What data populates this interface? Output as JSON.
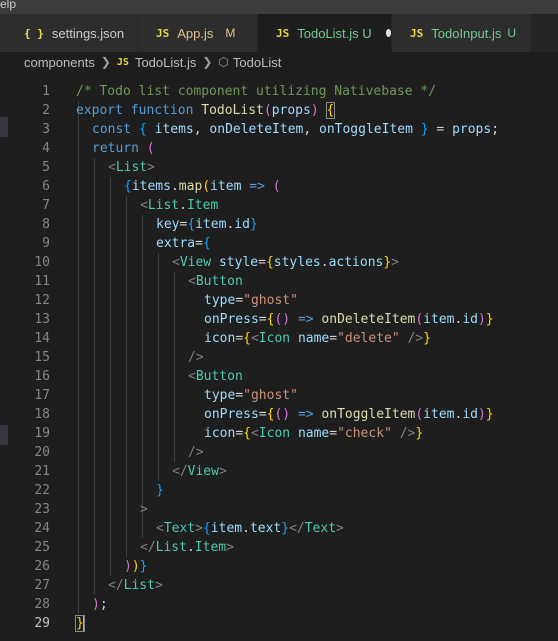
{
  "menubar": {
    "label": "elp"
  },
  "tabs": [
    {
      "icon": "{ }",
      "label": "settings.json",
      "status": ""
    },
    {
      "icon": "JS",
      "label": "App.js",
      "status": "M"
    },
    {
      "icon": "JS",
      "label": "TodoList.js U",
      "status": ""
    },
    {
      "icon": "JS",
      "label": "TodoInput.js",
      "status": "U"
    }
  ],
  "breadcrumb": {
    "folder": "components",
    "file_icon": "JS",
    "file": "TodoList.js",
    "symbol": "TodoList"
  },
  "colors": {
    "comment": "#6a9955",
    "keyword": "#569cd6",
    "function": "#dcdcaa",
    "variable": "#9cdcfe",
    "component": "#4ec9b0",
    "string": "#ce9178",
    "bracket1": "#ffd700",
    "bracket2": "#da70d6",
    "bracket3": "#179fff",
    "modified": "#e2c08d",
    "untracked": "#73c991"
  },
  "editor": {
    "current_line": 29,
    "lines": [
      {
        "n": 1,
        "tokens": [
          [
            "/* Todo list component utilizing Nativebase */",
            "com"
          ]
        ]
      },
      {
        "n": 2,
        "tokens": [
          [
            "export",
            "kw"
          ],
          [
            " ",
            "pun"
          ],
          [
            "function",
            "kw"
          ],
          [
            " ",
            "pun"
          ],
          [
            "TodoList",
            "fn"
          ],
          [
            "(",
            "br2"
          ],
          [
            "props",
            "var"
          ],
          [
            ")",
            "br2"
          ],
          [
            " ",
            "pun"
          ],
          [
            "{",
            "br1"
          ]
        ]
      },
      {
        "n": 3,
        "tokens": [
          [
            "const",
            "kw"
          ],
          [
            " ",
            "pun"
          ],
          [
            "{",
            "br3"
          ],
          [
            " ",
            "pun"
          ],
          [
            "items",
            "var"
          ],
          [
            ", ",
            "pun"
          ],
          [
            "onDeleteItem",
            "var"
          ],
          [
            ", ",
            "pun"
          ],
          [
            "onToggleItem",
            "var"
          ],
          [
            " ",
            "pun"
          ],
          [
            "}",
            "br3"
          ],
          [
            " = ",
            "pun"
          ],
          [
            "props",
            "var"
          ],
          [
            ";",
            "pun"
          ]
        ]
      },
      {
        "n": 4,
        "tokens": [
          [
            "return",
            "kw"
          ],
          [
            " ",
            "pun"
          ],
          [
            "(",
            "br2"
          ]
        ]
      },
      {
        "n": 5,
        "tokens": [
          [
            "<",
            "tag"
          ],
          [
            "List",
            "cmp"
          ],
          [
            ">",
            "tag"
          ]
        ]
      },
      {
        "n": 6,
        "tokens": [
          [
            "{",
            "br3"
          ],
          [
            "items",
            "var"
          ],
          [
            ".",
            "pun"
          ],
          [
            "map",
            "fn"
          ],
          [
            "(",
            "br1"
          ],
          [
            "item",
            "var"
          ],
          [
            " ",
            "pun"
          ],
          [
            "=>",
            "kw"
          ],
          [
            " ",
            "pun"
          ],
          [
            "(",
            "br2"
          ]
        ]
      },
      {
        "n": 7,
        "tokens": [
          [
            "<",
            "tag"
          ],
          [
            "List",
            "cmp"
          ],
          [
            ".",
            "pun"
          ],
          [
            "Item",
            "cmp"
          ]
        ]
      },
      {
        "n": 8,
        "tokens": [
          [
            "key",
            "var"
          ],
          [
            "=",
            "pun"
          ],
          [
            "{",
            "br3"
          ],
          [
            "item",
            "var"
          ],
          [
            ".",
            "pun"
          ],
          [
            "id",
            "var"
          ],
          [
            "}",
            "br3"
          ]
        ]
      },
      {
        "n": 9,
        "tokens": [
          [
            "extra",
            "var"
          ],
          [
            "=",
            "pun"
          ],
          [
            "{",
            "br3"
          ]
        ]
      },
      {
        "n": 10,
        "tokens": [
          [
            "<",
            "tag"
          ],
          [
            "View",
            "cmp"
          ],
          [
            " ",
            "pun"
          ],
          [
            "style",
            "var"
          ],
          [
            "=",
            "pun"
          ],
          [
            "{",
            "br1"
          ],
          [
            "styles",
            "var"
          ],
          [
            ".",
            "pun"
          ],
          [
            "actions",
            "var"
          ],
          [
            "}",
            "br1"
          ],
          [
            ">",
            "tag"
          ]
        ]
      },
      {
        "n": 11,
        "tokens": [
          [
            "<",
            "tag"
          ],
          [
            "Button",
            "cmp"
          ]
        ]
      },
      {
        "n": 12,
        "tokens": [
          [
            "type",
            "var"
          ],
          [
            "=",
            "pun"
          ],
          [
            "\"ghost\"",
            "str"
          ]
        ]
      },
      {
        "n": 13,
        "tokens": [
          [
            "onPress",
            "var"
          ],
          [
            "=",
            "pun"
          ],
          [
            "{",
            "br1"
          ],
          [
            "()",
            "br2"
          ],
          [
            " ",
            "pun"
          ],
          [
            "=>",
            "kw"
          ],
          [
            " ",
            "pun"
          ],
          [
            "onDeleteItem",
            "fn"
          ],
          [
            "(",
            "br2"
          ],
          [
            "item",
            "var"
          ],
          [
            ".",
            "pun"
          ],
          [
            "id",
            "var"
          ],
          [
            ")",
            "br2"
          ],
          [
            "}",
            "br1"
          ]
        ]
      },
      {
        "n": 14,
        "tokens": [
          [
            "icon",
            "var"
          ],
          [
            "=",
            "pun"
          ],
          [
            "{",
            "br1"
          ],
          [
            "<",
            "tag"
          ],
          [
            "Icon",
            "cmp"
          ],
          [
            " ",
            "pun"
          ],
          [
            "name",
            "var"
          ],
          [
            "=",
            "pun"
          ],
          [
            "\"delete\"",
            "str"
          ],
          [
            " ",
            "pun"
          ],
          [
            "/>",
            "tag"
          ],
          [
            "}",
            "br1"
          ]
        ]
      },
      {
        "n": 15,
        "tokens": [
          [
            "/>",
            "tag"
          ]
        ]
      },
      {
        "n": 16,
        "tokens": [
          [
            "<",
            "tag"
          ],
          [
            "Button",
            "cmp"
          ]
        ]
      },
      {
        "n": 17,
        "tokens": [
          [
            "type",
            "var"
          ],
          [
            "=",
            "pun"
          ],
          [
            "\"ghost\"",
            "str"
          ]
        ]
      },
      {
        "n": 18,
        "tokens": [
          [
            "onPress",
            "var"
          ],
          [
            "=",
            "pun"
          ],
          [
            "{",
            "br1"
          ],
          [
            "()",
            "br2"
          ],
          [
            " ",
            "pun"
          ],
          [
            "=>",
            "kw"
          ],
          [
            " ",
            "pun"
          ],
          [
            "onToggleItem",
            "fn"
          ],
          [
            "(",
            "br2"
          ],
          [
            "item",
            "var"
          ],
          [
            ".",
            "pun"
          ],
          [
            "id",
            "var"
          ],
          [
            ")",
            "br2"
          ],
          [
            "}",
            "br1"
          ]
        ]
      },
      {
        "n": 19,
        "tokens": [
          [
            "icon",
            "var"
          ],
          [
            "=",
            "pun"
          ],
          [
            "{",
            "br1"
          ],
          [
            "<",
            "tag"
          ],
          [
            "Icon",
            "cmp"
          ],
          [
            " ",
            "pun"
          ],
          [
            "name",
            "var"
          ],
          [
            "=",
            "pun"
          ],
          [
            "\"check\"",
            "str"
          ],
          [
            " ",
            "pun"
          ],
          [
            "/>",
            "tag"
          ],
          [
            "}",
            "br1"
          ]
        ]
      },
      {
        "n": 20,
        "tokens": [
          [
            "/>",
            "tag"
          ]
        ]
      },
      {
        "n": 21,
        "tokens": [
          [
            "</",
            "tag"
          ],
          [
            "View",
            "cmp"
          ],
          [
            ">",
            "tag"
          ]
        ]
      },
      {
        "n": 22,
        "tokens": [
          [
            "}",
            "br3"
          ]
        ]
      },
      {
        "n": 23,
        "tokens": [
          [
            ">",
            "tag"
          ]
        ]
      },
      {
        "n": 24,
        "tokens": [
          [
            "<",
            "tag"
          ],
          [
            "Text",
            "cmp"
          ],
          [
            ">",
            "tag"
          ],
          [
            "{",
            "br3"
          ],
          [
            "item",
            "var"
          ],
          [
            ".",
            "pun"
          ],
          [
            "text",
            "var"
          ],
          [
            "}",
            "br3"
          ],
          [
            "</",
            "tag"
          ],
          [
            "Text",
            "cmp"
          ],
          [
            ">",
            "tag"
          ]
        ]
      },
      {
        "n": 25,
        "tokens": [
          [
            "</",
            "tag"
          ],
          [
            "List",
            "cmp"
          ],
          [
            ".",
            "pun"
          ],
          [
            "Item",
            "cmp"
          ],
          [
            ">",
            "tag"
          ]
        ]
      },
      {
        "n": 26,
        "tokens": [
          [
            ")",
            "br2"
          ],
          [
            ")",
            "br1"
          ],
          [
            "}",
            "br3"
          ]
        ]
      },
      {
        "n": 27,
        "tokens": [
          [
            "</",
            "tag"
          ],
          [
            "List",
            "cmp"
          ],
          [
            ">",
            "tag"
          ]
        ]
      },
      {
        "n": 28,
        "tokens": [
          [
            ")",
            "br2"
          ],
          [
            ";",
            "pun"
          ]
        ]
      },
      {
        "n": 29,
        "tokens": [
          [
            "}",
            "br1"
          ]
        ]
      }
    ]
  }
}
